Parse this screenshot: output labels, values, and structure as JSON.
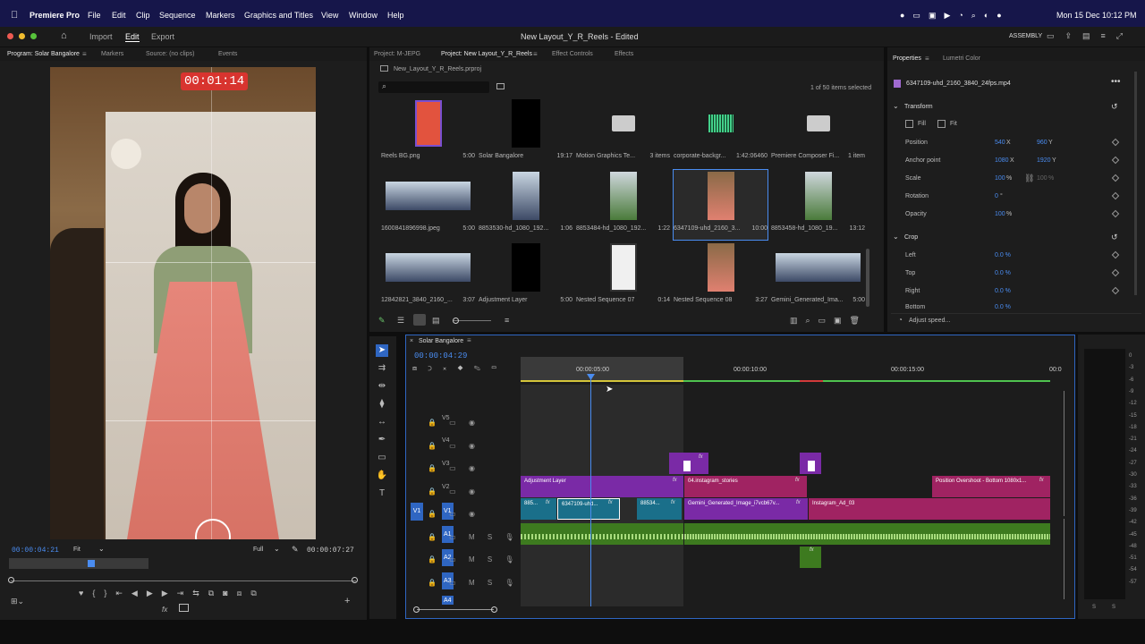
{
  "menubar": {
    "app_name": "Premiere Pro",
    "items": [
      "File",
      "Edit",
      "Clip",
      "Sequence",
      "Markers",
      "Graphics and Titles",
      "View",
      "Window",
      "Help"
    ],
    "clock": "Mon 15 Dec  10:12 PM"
  },
  "apptoolbar": {
    "import": "Import",
    "edit": "Edit",
    "export": "Export",
    "title": "New Layout_Y_R_Reels - Edited",
    "workspace": "ASSEMBLY"
  },
  "program": {
    "tabs": [
      "Program: Solar Bangalore",
      "Markers",
      "Source: (no clips)",
      "Events"
    ],
    "overlay_timer": "00:01:14",
    "timecode": "00:00:04:21",
    "fit": "Fit",
    "quality": "Full",
    "duration": "00:00:07:27"
  },
  "project": {
    "tabs": [
      "Project: M-JEPG",
      "Project: New Layout_Y_R_Reels",
      "Effect Controls",
      "Effects"
    ],
    "file": "New_Layout_Y_R_Reels.prproj",
    "status": "1 of 50 items selected",
    "items": [
      {
        "name": "Reels BG.png",
        "dur": "5:00",
        "kind": "image"
      },
      {
        "name": "Solar Bangalore",
        "dur": "19:17",
        "kind": "black"
      },
      {
        "name": "Motion Graphics Te...",
        "dur": "3 items",
        "kind": "folder"
      },
      {
        "name": "corporate-backgr...",
        "dur": "1:42:06460",
        "kind": "audio"
      },
      {
        "name": "Premiere Composer Fi...",
        "dur": "1 item",
        "kind": "folder"
      },
      {
        "name": "1600841896998.jpeg",
        "dur": "5:00",
        "kind": "solar"
      },
      {
        "name": "8853530-hd_1080_192...",
        "dur": "1:06",
        "kind": "solar"
      },
      {
        "name": "8853484-hd_1080_192...",
        "dur": "1:22",
        "kind": "worker"
      },
      {
        "name": "6347109-uhd_2160_3...",
        "dur": "10:00",
        "kind": "woman",
        "selected": true
      },
      {
        "name": "8853458-hd_1080_19...",
        "dur": "13:12",
        "kind": "worker"
      },
      {
        "name": "12842821_3840_2160_...",
        "dur": "3:07",
        "kind": "solar"
      },
      {
        "name": "Adjustment Layer",
        "dur": "5:00",
        "kind": "black"
      },
      {
        "name": "Nested Sequence 07",
        "dur": "0:14",
        "kind": "doc"
      },
      {
        "name": "Nested Sequence 08",
        "dur": "3:27",
        "kind": "woman"
      },
      {
        "name": "Gemini_Generated_Ima...",
        "dur": "5:00",
        "kind": "solar"
      }
    ]
  },
  "properties": {
    "tabs": [
      "Properties",
      "Lumetri Color"
    ],
    "clip": "6347109-uhd_2160_3840_24fps.mp4",
    "transform": "Transform",
    "fill": "Fill",
    "fit": "Fit",
    "rows": [
      {
        "label": "Position",
        "v1": "540",
        "u1": "X",
        "v2": "960",
        "u2": "Y"
      },
      {
        "label": "Anchor point",
        "v1": "1080",
        "u1": "X",
        "v2": "1920",
        "u2": "Y"
      },
      {
        "label": "Scale",
        "v1": "100",
        "u1": "%",
        "v2": "100",
        "u2": "%"
      },
      {
        "label": "Rotation",
        "v1": "0",
        "u1": "°",
        "v2": "",
        "u2": ""
      },
      {
        "label": "Opacity",
        "v1": "100",
        "u1": "%",
        "v2": "",
        "u2": ""
      }
    ],
    "crop": "Crop",
    "crop_rows": [
      {
        "label": "Left",
        "v": "0.0 %"
      },
      {
        "label": "Top",
        "v": "0.0 %"
      },
      {
        "label": "Right",
        "v": "0.0 %"
      },
      {
        "label": "Bottom",
        "v": "0.0 %"
      }
    ],
    "adjust_speed": "Adjust speed..."
  },
  "timeline": {
    "tab": "Solar Bangalore",
    "timecode": "00:00:04:29",
    "ruler": [
      "00:00:05:00",
      "00:00:10:00",
      "00:00:15:00",
      "00:0"
    ],
    "video_tracks": [
      "V5",
      "V4",
      "V3",
      "V2",
      "V1"
    ],
    "audio_tracks": [
      "A1",
      "A2",
      "A3",
      "A4"
    ],
    "source_v1": "V1",
    "clips": {
      "adjustment": "Adjustment Layer",
      "stories": "04.instagram_stories",
      "overshoot": "Position Overshoot - Bottom 1080x1...",
      "c885": "885...",
      "c6347": "6347109-uhd...",
      "c8853": "88534...",
      "gemini": "Gemini_Generated_Image_i7vcb67v...",
      "insta": "Instagram_Ad_03"
    },
    "fx": "fx",
    "meter_ticks": [
      "0",
      "-3",
      "-6",
      "-9",
      "-12",
      "-15",
      "-18",
      "-21",
      "-24",
      "-27",
      "-30",
      "-33",
      "-36",
      "-39",
      "-42",
      "-45",
      "-48",
      "-51",
      "-54",
      "-57"
    ],
    "meter_s": "S"
  }
}
